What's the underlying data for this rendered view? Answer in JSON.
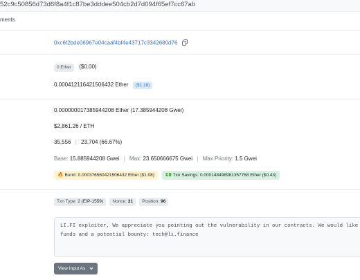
{
  "header": {
    "tx_hash_partial": "52c9c50856d73d6f8a4f1c87be3dddee504cb2d7d094f65ef7cc67ab",
    "section_title": "ments"
  },
  "address": {
    "value": "0xc6f2bde06967e04caaf4bf4e43717c3342680d76",
    "copy_icon": "copy-icon"
  },
  "value": {
    "ether_pill": "0 Ether",
    "usd": "($0.00)"
  },
  "fee": {
    "amount": "0.000412116421506432 Ether",
    "usd_pill": "($1.18)"
  },
  "gas": {
    "gas_price": "0.000000017385944208 Ether (17.385944208 Gwei)",
    "eth_price": "$2,861.26 / ETH",
    "gas_limit": "35,556",
    "gas_used": "23,704 (66.67%)",
    "base_label": "Base:",
    "base_value": "15.885944208 Gwei",
    "max_label": "Max:",
    "max_value": "23.650666675 Gwei",
    "priority_label": "Max Priority:",
    "priority_value": "1.5 Gwei",
    "burnt": "Burnt: 0.000376560421506432 Ether ($1.08)",
    "savings": "Txn Savings: 0.000148498981357768 Ether ($0.43)",
    "burnt_icon": "fire-icon",
    "savings_icon": "money-icon"
  },
  "attributes": {
    "txn_type_label": "Txn Type:",
    "txn_type_value": "2 (EIP-1559)",
    "nonce_label": "Nonce:",
    "nonce_value": "31",
    "position_label": "Position:",
    "position_value": "96"
  },
  "input_data": {
    "line1": "LI.FI exploiter, We appreciate you pointing out the vulnerability in our contracts. We would like to",
    "line2": "funds and a potential bounty: tech@li.finance",
    "view_button": "View Input As",
    "chevron_icon": "chevron-down-icon"
  },
  "colors": {
    "link": "#3b73c8",
    "muted": "#6c757d",
    "burnt_bg": "#fff3cd",
    "savings_bg": "#d7f2e3"
  }
}
